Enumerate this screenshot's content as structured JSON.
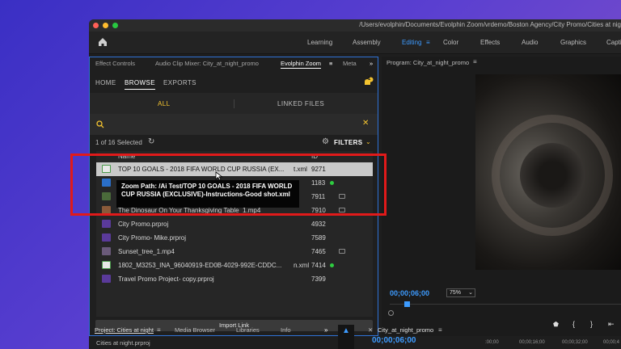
{
  "window": {
    "path": "/Users/evolphin/Documents/Evolphin Zoom/vrdemo/Boston Agency/City Promo/Cities at nig",
    "workspaces": [
      "Learning",
      "Assembly",
      "Editing",
      "Color",
      "Effects",
      "Audio",
      "Graphics",
      "Capti"
    ],
    "active_workspace": "Editing"
  },
  "left_panel": {
    "tabs": [
      "Effect Controls",
      "Audio Clip Mixer: City_at_night_promo",
      "Evolphin Zoom",
      "Meta"
    ],
    "nav": [
      "HOME",
      "BROWSE",
      "EXPORTS"
    ],
    "notification_count": "1",
    "filters": {
      "all": "ALL",
      "linked": "LINKED FILES"
    },
    "selection_text": "1 of 16 Selected",
    "filters_label": "FILTERS",
    "list_header": {
      "name": "Name",
      "id": "ID"
    },
    "items": [
      {
        "name": "TOP 10 GOALS - 2018 FIFA WORLD CUP RUSSIA (EX...",
        "ext": "t.xml",
        "id": "9271"
      },
      {
        "name": "",
        "ext": "",
        "id": "1183"
      },
      {
        "name": "",
        "ext": "",
        "id": "7911"
      },
      {
        "name": "The Dinosaur On Your Thanksgiving Table_1.mp4",
        "ext": "",
        "id": "7910"
      },
      {
        "name": "City Promo.prproj",
        "ext": "",
        "id": "4932"
      },
      {
        "name": "City Promo- Mike.prproj",
        "ext": "",
        "id": "7589"
      },
      {
        "name": "Sunset_tree_1.mp4",
        "ext": "",
        "id": "7465"
      },
      {
        "name": "1802_M3253_INA_96040919-ED0B-4029-992E-CDDC...",
        "ext": "n.xml",
        "id": "7414"
      },
      {
        "name": "Travel Promo Project- copy.prproj",
        "ext": "",
        "id": "7399"
      }
    ],
    "tooltip": "Zoom Path: /Ai Test/TOP 10 GOALS - 2018 FIFA WORLD CUP RUSSIA (EXCLUSIVE)-Instructions-Good shot.xml",
    "import_button": "Import Link"
  },
  "program": {
    "title": "Program: City_at_night_promo",
    "timecode": "00;00;06;00",
    "zoom": "75%"
  },
  "bottom": {
    "project_tab": "Project: Cities at night",
    "tabs": [
      "Media Browser",
      "Libraries",
      "Info"
    ],
    "sequence_tab": "City_at_night_promo",
    "timecode": "00;00;06;00",
    "file": "Cities at night.prproj",
    "ruler": [
      ":00;00",
      "00;00;16;00",
      "00;00;32;00",
      "00;00;4"
    ]
  },
  "colors": {
    "accent": "#3d9bff",
    "highlight": "#e11a1a",
    "yellow": "#f4c430"
  }
}
